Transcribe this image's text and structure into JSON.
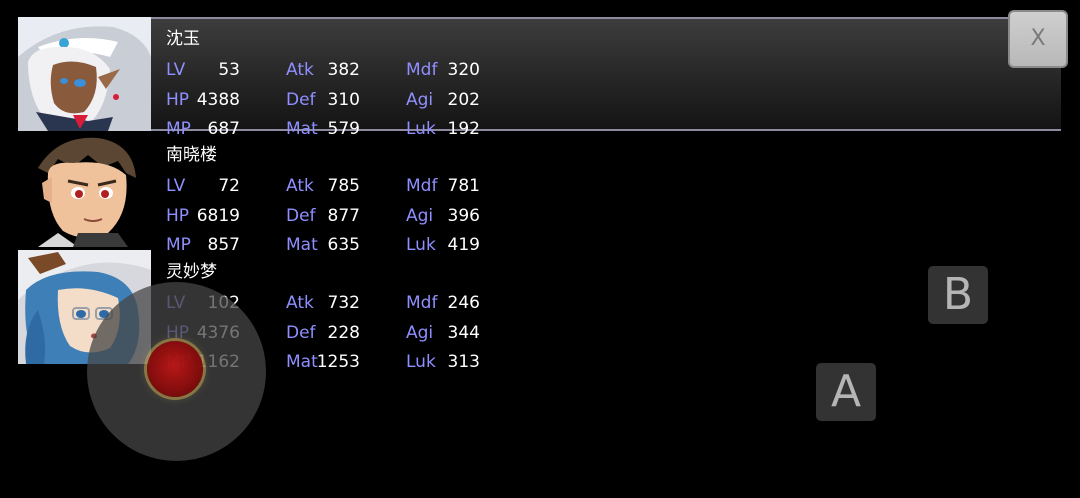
{
  "close_button": {
    "label": "X"
  },
  "touch_controls": {
    "button_b": "B",
    "button_a": "A"
  },
  "stat_labels": {
    "lv": "LV",
    "hp": "HP",
    "mp": "MP",
    "atk": "Atk",
    "def": "Def",
    "mat": "Mat",
    "mdf": "Mdf",
    "agi": "Agi",
    "luk": "Luk"
  },
  "party": [
    {
      "name": "沈玉",
      "portrait": "white-haired-dark-skinned-witch-portrait",
      "lv": "53",
      "hp": "4388",
      "mp": "687",
      "atk": "382",
      "def": "310",
      "mat": "579",
      "mdf": "320",
      "agi": "202",
      "luk": "192"
    },
    {
      "name": "南晓楼",
      "portrait": "brown-haired-boy-portrait",
      "lv": "72",
      "hp": "6819",
      "mp": "857",
      "atk": "785",
      "def": "877",
      "mat": "635",
      "mdf": "781",
      "agi": "396",
      "luk": "419"
    },
    {
      "name": "灵妙梦",
      "portrait": "blue-haired-witch-with-glasses-portrait",
      "lv": "102",
      "hp": "4376",
      "mp": "1162",
      "atk": "732",
      "def": "228",
      "mat": "1253",
      "mdf": "246",
      "agi": "344",
      "luk": "313"
    }
  ],
  "colors": {
    "stat_label": "#8f8fff",
    "stat_value": "#ffffff",
    "highlight_border": "#8e8aa0",
    "joystick_knob": "#a50f0f"
  }
}
